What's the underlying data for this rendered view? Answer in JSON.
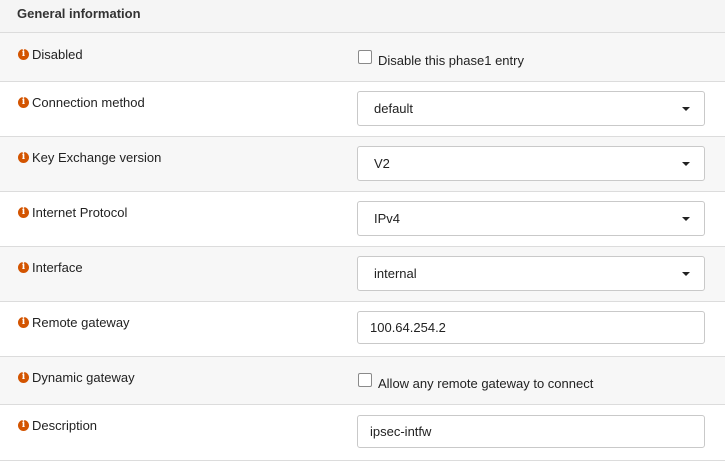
{
  "section": {
    "title": "General information"
  },
  "info_glyph": "i",
  "fields": {
    "disabled": {
      "label": "Disabled",
      "checkbox_label": "Disable this phase1 entry",
      "checked": false
    },
    "connection_method": {
      "label": "Connection method",
      "value": "default"
    },
    "key_exchange": {
      "label": "Key Exchange version",
      "value": "V2"
    },
    "internet_protocol": {
      "label": "Internet Protocol",
      "value": "IPv4"
    },
    "interface": {
      "label": "Interface",
      "value": "internal"
    },
    "remote_gateway": {
      "label": "Remote gateway",
      "value": "100.64.254.2"
    },
    "dynamic_gateway": {
      "label": "Dynamic gateway",
      "checkbox_label": "Allow any remote gateway to connect",
      "checked": false
    },
    "description": {
      "label": "Description",
      "value": "ipsec-intfw"
    }
  },
  "colors": {
    "info_icon": "#d35400",
    "row_alt": "#f7f7f7",
    "border": "#dcdcdc"
  }
}
